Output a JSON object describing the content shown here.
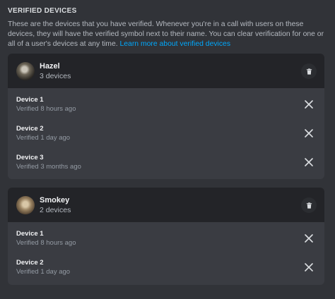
{
  "section": {
    "title": "VERIFIED DEVICES",
    "description": "These are the devices that you have verified. Whenever you're in a call with users on these devices, they will have the verified symbol next to their name. You can clear verification for one or all of a user's devices at any time.",
    "link": "Learn more about verified devices"
  },
  "users": [
    {
      "name": "Hazel",
      "count": "3 devices",
      "devices": [
        {
          "name": "Device 1",
          "time": "Verified 8 hours ago"
        },
        {
          "name": "Device 2",
          "time": "Verified 1 day ago"
        },
        {
          "name": "Device 3",
          "time": "Verified 3 months ago"
        }
      ]
    },
    {
      "name": "Smokey",
      "count": "2 devices",
      "devices": [
        {
          "name": "Device 1",
          "time": "Verified 8 hours ago"
        },
        {
          "name": "Device 2",
          "time": "Verified 1 day ago"
        }
      ]
    }
  ],
  "icons": {
    "delete": "trash-icon",
    "remove": "close-icon"
  },
  "colors": {
    "background": "#313338",
    "card": "#3a3c42",
    "card_header": "#232428",
    "link": "#00a8fc"
  }
}
